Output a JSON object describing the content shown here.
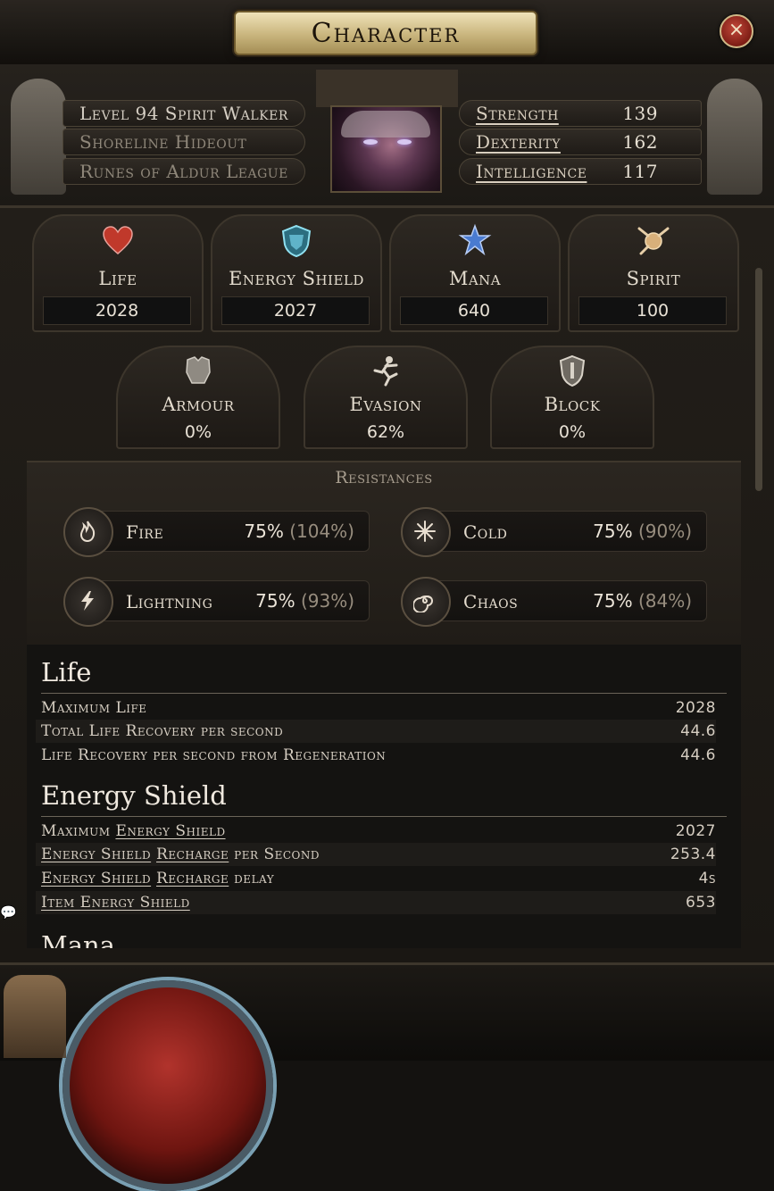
{
  "window": {
    "title": "Character",
    "close_glyph": "×"
  },
  "header": {
    "info": [
      {
        "text": "Level 94 Spirit Walker",
        "dim": false
      },
      {
        "text": "Shoreline Hideout",
        "dim": true
      },
      {
        "text": "Runes of Aldur League",
        "dim": true
      }
    ],
    "attributes": [
      {
        "name": "Strength",
        "value": "139"
      },
      {
        "name": "Dexterity",
        "value": "162"
      },
      {
        "name": "Intelligence",
        "value": "117"
      }
    ]
  },
  "pools": [
    {
      "label": "Life",
      "value": "2028",
      "icon": "heart-icon",
      "color": "#c0392b"
    },
    {
      "label": "Energy Shield",
      "value": "2027",
      "icon": "energy-shield-icon",
      "color": "#5fb3c9"
    },
    {
      "label": "Mana",
      "value": "640",
      "icon": "mana-icon",
      "color": "#4a7bd0"
    },
    {
      "label": "Spirit",
      "value": "100",
      "icon": "spirit-icon",
      "color": "#d8b07a"
    }
  ],
  "defences": [
    {
      "label": "Armour",
      "value": "0%",
      "icon": "armour-icon"
    },
    {
      "label": "Evasion",
      "value": "62%",
      "icon": "evasion-icon"
    },
    {
      "label": "Block",
      "value": "0%",
      "icon": "block-icon"
    }
  ],
  "resistances": {
    "title": "Resistances",
    "items": [
      {
        "name": "Fire",
        "value": "75%",
        "max": "(104%)",
        "icon": "fire-icon"
      },
      {
        "name": "Cold",
        "value": "75%",
        "max": "(90%)",
        "icon": "cold-icon"
      },
      {
        "name": "Lightning",
        "value": "75%",
        "max": "(93%)",
        "icon": "lightning-icon"
      },
      {
        "name": "Chaos",
        "value": "75%",
        "max": "(84%)",
        "icon": "chaos-icon"
      }
    ]
  },
  "stats": {
    "life": {
      "heading": "Life",
      "rows": [
        {
          "label": "Maximum Life",
          "value": "2028"
        },
        {
          "label": "Total Life Recovery per second",
          "value": "44.6"
        },
        {
          "label": "Life Recovery per second from Regeneration",
          "value": "44.6"
        }
      ]
    },
    "energy_shield": {
      "heading": "Energy Shield",
      "rows": [
        {
          "pre": "Maximum ",
          "link1": "Energy Shield",
          "link2": "",
          "post": "",
          "value": "2027"
        },
        {
          "pre": "",
          "link1": "Energy Shield",
          "link2": "Recharge",
          "post": " per Second",
          "value": "253.4"
        },
        {
          "pre": "",
          "link1": "Energy Shield",
          "link2": "Recharge",
          "post": " delay",
          "value": "4s"
        },
        {
          "pre": "",
          "link1": "Item Energy Shield",
          "link2": "",
          "post": "",
          "value": "653"
        }
      ]
    },
    "mana": {
      "heading": "Mana"
    }
  }
}
